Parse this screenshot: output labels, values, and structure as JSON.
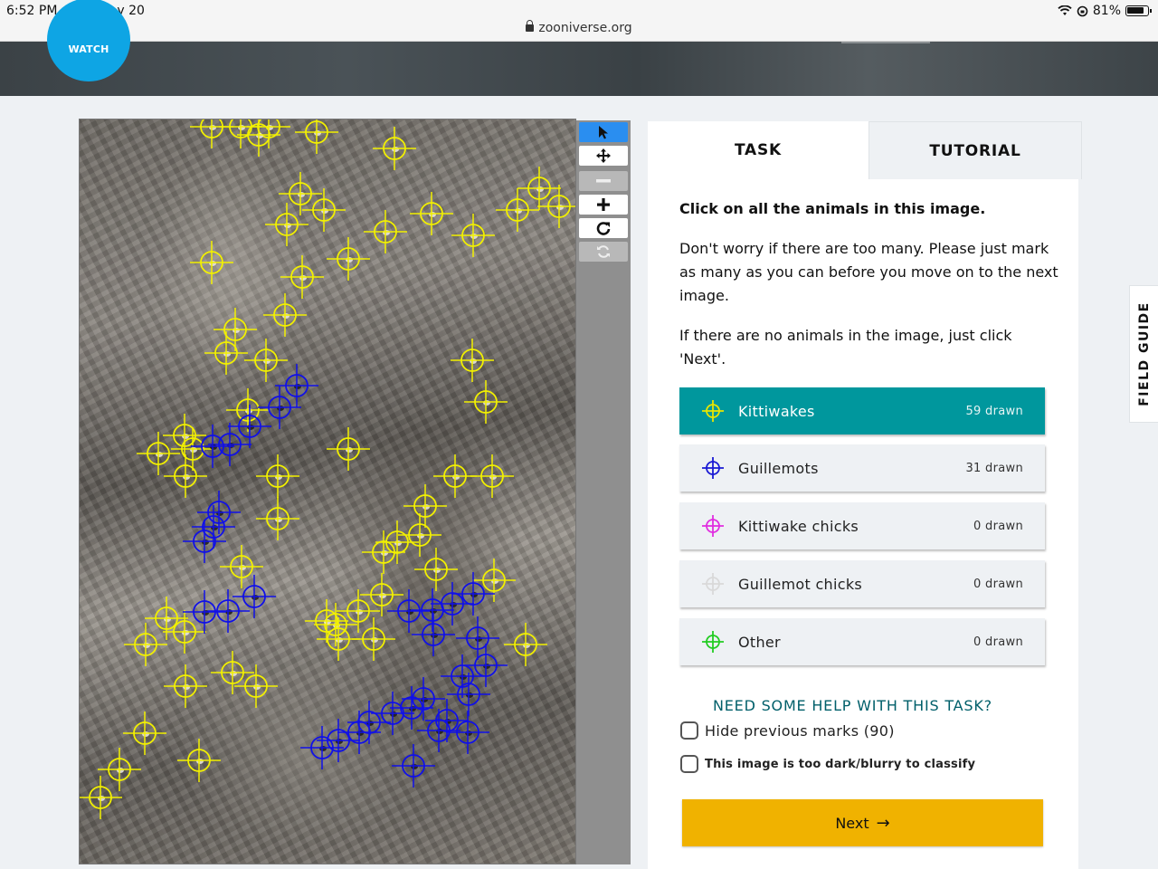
{
  "status": {
    "time": "6:52 PM",
    "date": "Thu May 20",
    "battery": "81%",
    "url": "zooniverse.org"
  },
  "project": {
    "logo_text": "WATCH"
  },
  "toolbar": {
    "buttons": [
      "pointer-icon",
      "move-icon",
      "zoom-out-icon",
      "zoom-in-icon",
      "rotate-icon",
      "reset-icon"
    ]
  },
  "tabs": {
    "task": "TASK",
    "tutorial": "TUTORIAL"
  },
  "task": {
    "question": "Click on all the animals in this image.",
    "help_1": "Don't worry if there are too many. Please just mark as many as you can before you move on to the next image.",
    "help_2": "If there are no animals in the image, just click 'Next'.",
    "choices": [
      {
        "label": "Kittiwakes",
        "count": "59 drawn",
        "color": "#e8e600",
        "selected": true
      },
      {
        "label": "Guillemots",
        "count": "31 drawn",
        "color": "#1a1ad4",
        "selected": false
      },
      {
        "label": "Kittiwake chicks",
        "count": "0 drawn",
        "color": "#e02ee0",
        "selected": false
      },
      {
        "label": "Guillemot chicks",
        "count": "0 drawn",
        "color": "#d9d9d9",
        "selected": false
      },
      {
        "label": "Other",
        "count": "0 drawn",
        "color": "#22cc22",
        "selected": false
      }
    ],
    "need_help": "NEED SOME HELP WITH THIS TASK?",
    "hide_marks": "Hide previous marks (90)",
    "too_dark": "This image is too dark/blurry to classify",
    "next": "Next",
    "next_arrow": "→"
  },
  "field_guide": "FIELD GUIDE",
  "colors": {
    "kittiwake_mark": "#f2f000",
    "guillemot_mark": "#1010e8",
    "selected_choice": "#00979d",
    "next_button": "#f0b200"
  }
}
